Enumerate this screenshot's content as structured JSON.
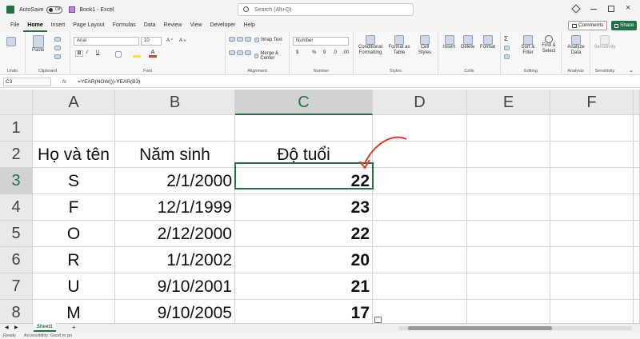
{
  "titlebar": {
    "autosave": "AutoSave",
    "toggle": "Off",
    "book": "Book1 - Excel",
    "search": "Search (Alt+Q)"
  },
  "tabs": [
    "File",
    "Home",
    "Insert",
    "Page Layout",
    "Formulas",
    "Data",
    "Review",
    "View",
    "Developer",
    "Help"
  ],
  "actions": {
    "comments": "Comments",
    "share": "Share"
  },
  "ribbon": {
    "undo": "Undo",
    "paste": "Paste",
    "clipboard": "Clipboard",
    "font_name": "Arial",
    "font_size": "10",
    "font": "Font",
    "wrap": "Wrap Text",
    "merge": "Merge & Center",
    "alignment": "Alignment",
    "numfmt": "Number",
    "number": "Number",
    "cond": "Conditional Formatting",
    "fmt_table": "Format as Table",
    "cell_styles": "Cell Styles",
    "styles": "Styles",
    "insert": "Insert",
    "delete": "Delete",
    "format": "Format",
    "cells": "Cells",
    "sort": "Sort & Filter",
    "find": "Find & Select",
    "editing": "Editing",
    "analyze": "Analyze Data",
    "analysis": "Analysis",
    "sensitivity": "Sensitivity",
    "sens_group": "Sensitivity"
  },
  "formula_bar": {
    "namebox": "C3",
    "formula": "=YEAR(NOW())-YEAR(B3)"
  },
  "columns": [
    "A",
    "B",
    "C",
    "D",
    "E",
    "F"
  ],
  "rows": [
    "1",
    "2",
    "3",
    "4",
    "5",
    "6",
    "7",
    "8"
  ],
  "table": {
    "headers": [
      "Họ và tên",
      "Năm sinh",
      "Độ tuổi"
    ],
    "rows": [
      [
        "S",
        "2/1/2000",
        "22"
      ],
      [
        "F",
        "12/1/1999",
        "23"
      ],
      [
        "O",
        "2/12/2000",
        "22"
      ],
      [
        "R",
        "1/1/2002",
        "20"
      ],
      [
        "U",
        "9/10/2001",
        "21"
      ],
      [
        "M",
        "9/10/2005",
        "17"
      ]
    ]
  },
  "sheet": {
    "tab": "Sheet1",
    "add": "+"
  },
  "status": {
    "ready": "Ready",
    "accessibility": "Accessibility: Good to go"
  },
  "colors": {
    "accent": "#217346",
    "arrow": "#e03a2c"
  }
}
